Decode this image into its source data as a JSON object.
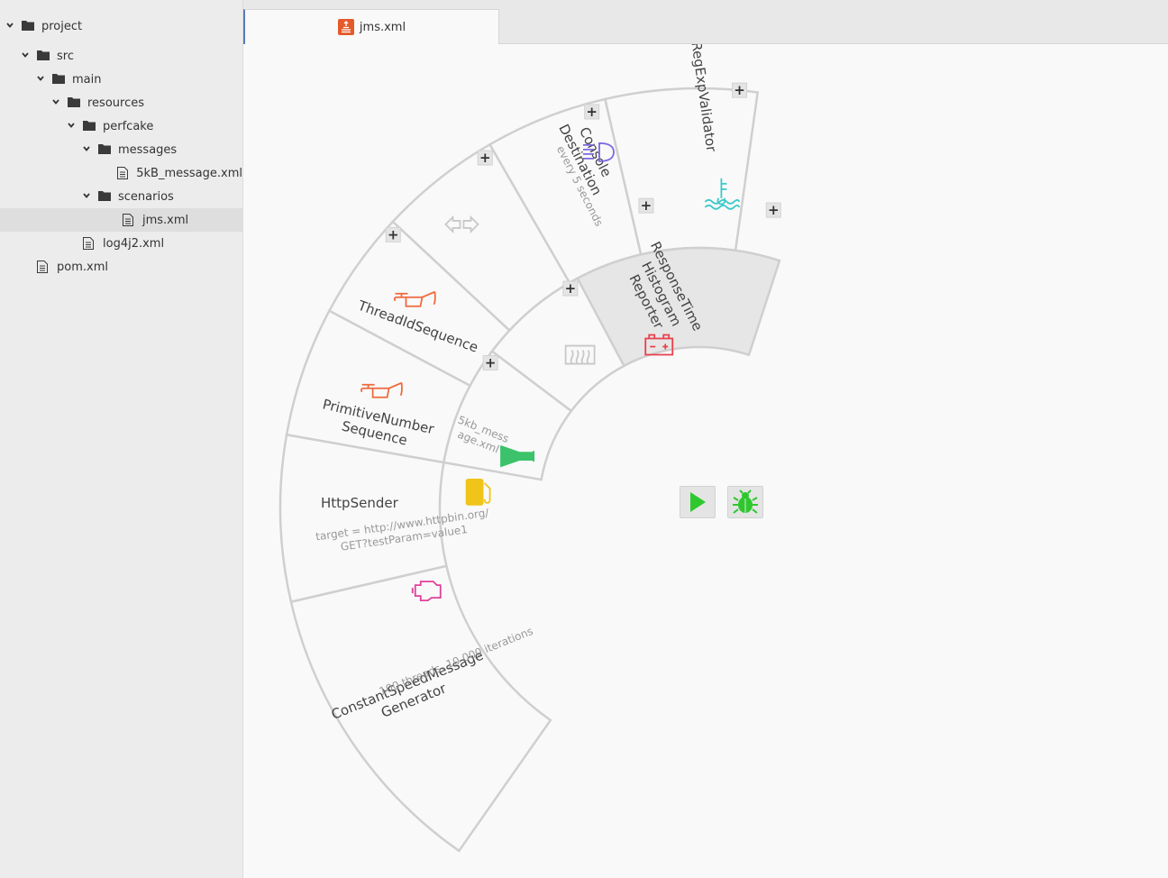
{
  "tree": [
    {
      "label": "project",
      "type": "folder",
      "level": 0,
      "expanded": true
    },
    {
      "label": "src",
      "type": "folder",
      "level": 1,
      "expanded": true
    },
    {
      "label": "main",
      "type": "folder",
      "level": 2,
      "expanded": true
    },
    {
      "label": "resources",
      "type": "folder",
      "level": 3,
      "expanded": true
    },
    {
      "label": "perfcake",
      "type": "folder",
      "level": 4,
      "expanded": true
    },
    {
      "label": "messages",
      "type": "folder",
      "level": 5,
      "expanded": true
    },
    {
      "label": "5kB_message.xml",
      "type": "file",
      "level": 6
    },
    {
      "label": "scenarios",
      "type": "folder",
      "level": 5,
      "expanded": true
    },
    {
      "label": "jms.xml",
      "type": "file",
      "level": 6,
      "selected": true
    },
    {
      "label": "log4j2.xml",
      "type": "file",
      "level": 4
    },
    {
      "label": "pom.xml",
      "type": "file",
      "level": 1
    }
  ],
  "editor": {
    "tab_label": "jms.xml"
  },
  "scenario": {
    "generator": {
      "name": [
        "ConstantSpeedMessage",
        "Generator"
      ],
      "detail": [
        "100 threads, 10 000 iterations"
      ],
      "icon": "engine-icon",
      "color": "#e0409a"
    },
    "sender": {
      "name": [
        "HttpSender"
      ],
      "detail": [
        "target = http://www.httpbin.org/",
        "GET?testParam=value1"
      ],
      "icon": "fuel-pump-icon",
      "color": "#f0c419"
    },
    "sequences": [
      {
        "name": [
          "PrimitiveNumber",
          "Sequence"
        ],
        "icon": "oil-can-icon",
        "color": "#f06a3c"
      },
      {
        "name": [
          "ThreadIdSequence"
        ],
        "icon": "oil-can-icon",
        "color": "#f06a3c"
      }
    ],
    "messages": [
      {
        "name": [
          "5kb_mess",
          "age.xml"
        ],
        "icon": "horn-icon",
        "color": "#3cc26a"
      }
    ],
    "receivers": [
      {
        "name": [],
        "icon": "bidirectional-arrows-icon",
        "color": "#c8c8c8"
      }
    ],
    "reporters": [
      {
        "name": [
          "ResponseTime",
          "Histogram",
          "Reporter"
        ],
        "icon": "battery-icon",
        "color": "#e8404a",
        "highlighted": true,
        "destinations": [
          {
            "name": [
              "Console",
              "Destination"
            ],
            "detail": "every 5 seconds",
            "icon": "headlight-icon",
            "color": "#7a6ae0"
          }
        ]
      }
    ],
    "validators": [
      {
        "name": [
          "RegExpValidator"
        ],
        "icon": "coolant-temperature-icon",
        "color": "#3cc8c8"
      }
    ],
    "empty_reporter_slot": {
      "icon": "defrost-icon",
      "color": "#c8c8c8"
    },
    "add_label": "+"
  },
  "controls": {
    "run_icon": "play-icon",
    "debug_icon": "bug-icon",
    "accent": "#2ec82e"
  }
}
